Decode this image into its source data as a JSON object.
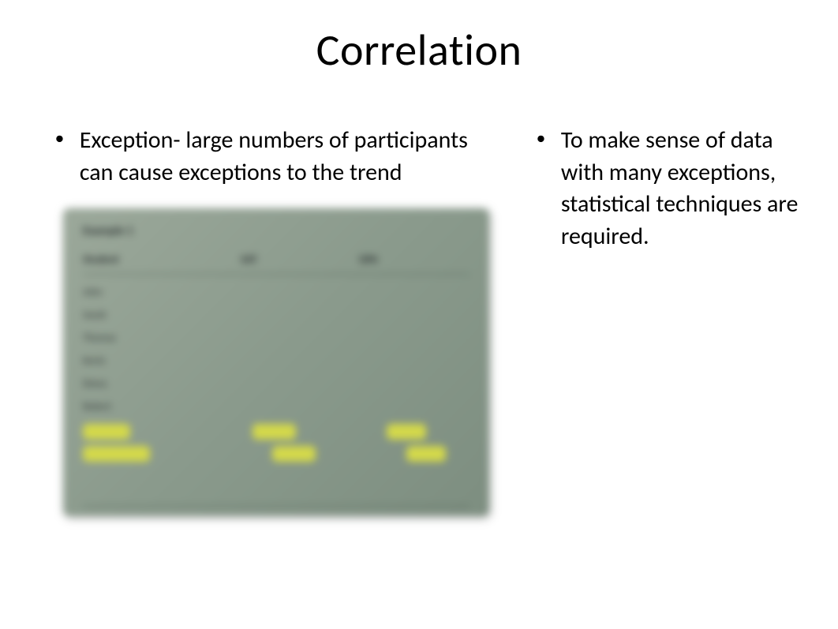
{
  "title": "Correlation",
  "left_bullet": "Exception- large numbers of participants can cause exceptions to the trend",
  "right_bullet": "To make sense of data with many exceptions, statistical techniques are required.",
  "table": {
    "caption": "Example 1",
    "headers": [
      "Student",
      "SAT",
      "GPA"
    ],
    "rows": [
      [
        "John",
        "",
        ""
      ],
      [
        "Sarah",
        "",
        ""
      ],
      [
        "Thomas",
        "",
        ""
      ],
      [
        "Kevin",
        "",
        ""
      ],
      [
        "Diana",
        "",
        ""
      ],
      [
        "Robert",
        "",
        ""
      ]
    ]
  }
}
